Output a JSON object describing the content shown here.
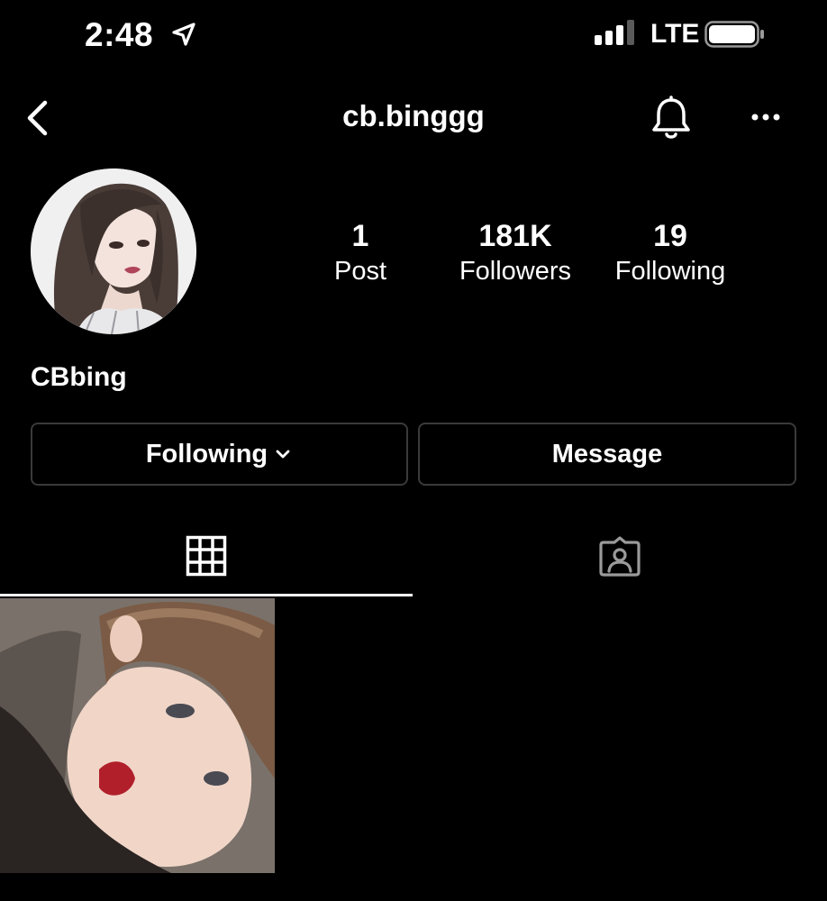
{
  "status_bar": {
    "time": "2:48",
    "network": "LTE"
  },
  "header": {
    "username": "cb.binggg"
  },
  "profile": {
    "display_name": "CBbing",
    "stats": [
      {
        "value": "1",
        "label": "Post"
      },
      {
        "value": "181K",
        "label": "Followers"
      },
      {
        "value": "19",
        "label": "Following"
      }
    ]
  },
  "actions": {
    "following_label": "Following",
    "message_label": "Message"
  },
  "tabs": [
    {
      "icon": "grid-icon",
      "active": true
    },
    {
      "icon": "tagged-icon",
      "active": false
    }
  ],
  "posts_count": 1,
  "colors": {
    "background": "#000000",
    "text": "#ffffff",
    "button_border": "#3a3a3a",
    "tab_inactive": "#9a9a9a"
  }
}
